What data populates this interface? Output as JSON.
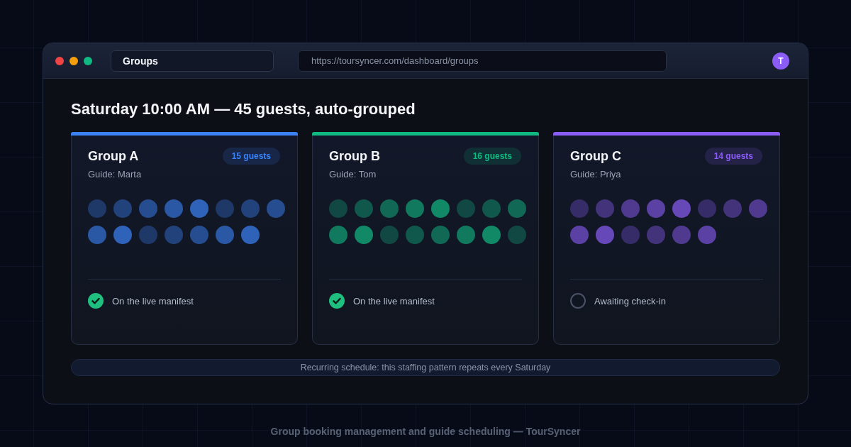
{
  "browser": {
    "tab_title": "Groups",
    "url": "https://toursyncer.com/dashboard/groups",
    "avatar_initial": "T"
  },
  "heading": "Saturday 10:00 AM — 45 guests, auto-grouped",
  "groups": [
    {
      "name": "Group A",
      "badge": "15 guests",
      "guide": "Guide: Marta",
      "color": "#3b82f6",
      "guests": [
        {
          "color": "#1e3867"
        },
        {
          "color": "#22427b"
        },
        {
          "color": "#264d8f"
        },
        {
          "color": "#2b58a4"
        },
        {
          "color": "#2f62b9"
        },
        {
          "color": "#1e3867"
        },
        {
          "color": "#22427b"
        },
        {
          "color": "#264d8f"
        },
        {
          "color": "#2b58a4"
        },
        {
          "color": "#2f62b9"
        },
        {
          "color": "#1e3867"
        },
        {
          "color": "#22427b"
        },
        {
          "color": "#264d8f"
        },
        {
          "color": "#2b58a4"
        },
        {
          "color": "#2f62b9"
        }
      ],
      "status": {
        "label": "On the live manifest",
        "checked": true
      }
    },
    {
      "name": "Group B",
      "badge": "16 guests",
      "guide": "Guide: Tom",
      "color": "#10b981",
      "guests": [
        {
          "color": "#114843"
        },
        {
          "color": "#11584c"
        },
        {
          "color": "#116855"
        },
        {
          "color": "#11795e"
        },
        {
          "color": "#118967"
        },
        {
          "color": "#114843"
        },
        {
          "color": "#11584c"
        },
        {
          "color": "#116855"
        },
        {
          "color": "#11795e"
        },
        {
          "color": "#118967"
        },
        {
          "color": "#114843"
        },
        {
          "color": "#11584c"
        },
        {
          "color": "#116855"
        },
        {
          "color": "#11795e"
        },
        {
          "color": "#118967"
        },
        {
          "color": "#114843"
        }
      ],
      "status": {
        "label": "On the live manifest",
        "checked": true
      }
    },
    {
      "name": "Group C",
      "badge": "14 guests",
      "guide": "Guide: Priya",
      "color": "#8b5cf6",
      "guests": [
        {
          "color": "#362c67"
        },
        {
          "color": "#42337b"
        },
        {
          "color": "#4f3a90"
        },
        {
          "color": "#5b41a4"
        },
        {
          "color": "#6748b9"
        },
        {
          "color": "#362c67"
        },
        {
          "color": "#42337b"
        },
        {
          "color": "#4f3a90"
        },
        {
          "color": "#5b41a4"
        },
        {
          "color": "#6748b9"
        },
        {
          "color": "#362c67"
        },
        {
          "color": "#42337b"
        },
        {
          "color": "#4f3a90"
        },
        {
          "color": "#5b41a4"
        }
      ],
      "status": {
        "label": "Awaiting check-in",
        "checked": false
      }
    }
  ],
  "footer_note": "Recurring schedule: this staffing pattern repeats every Saturday",
  "caption": "Group booking management and guide scheduling — TourSyncer"
}
